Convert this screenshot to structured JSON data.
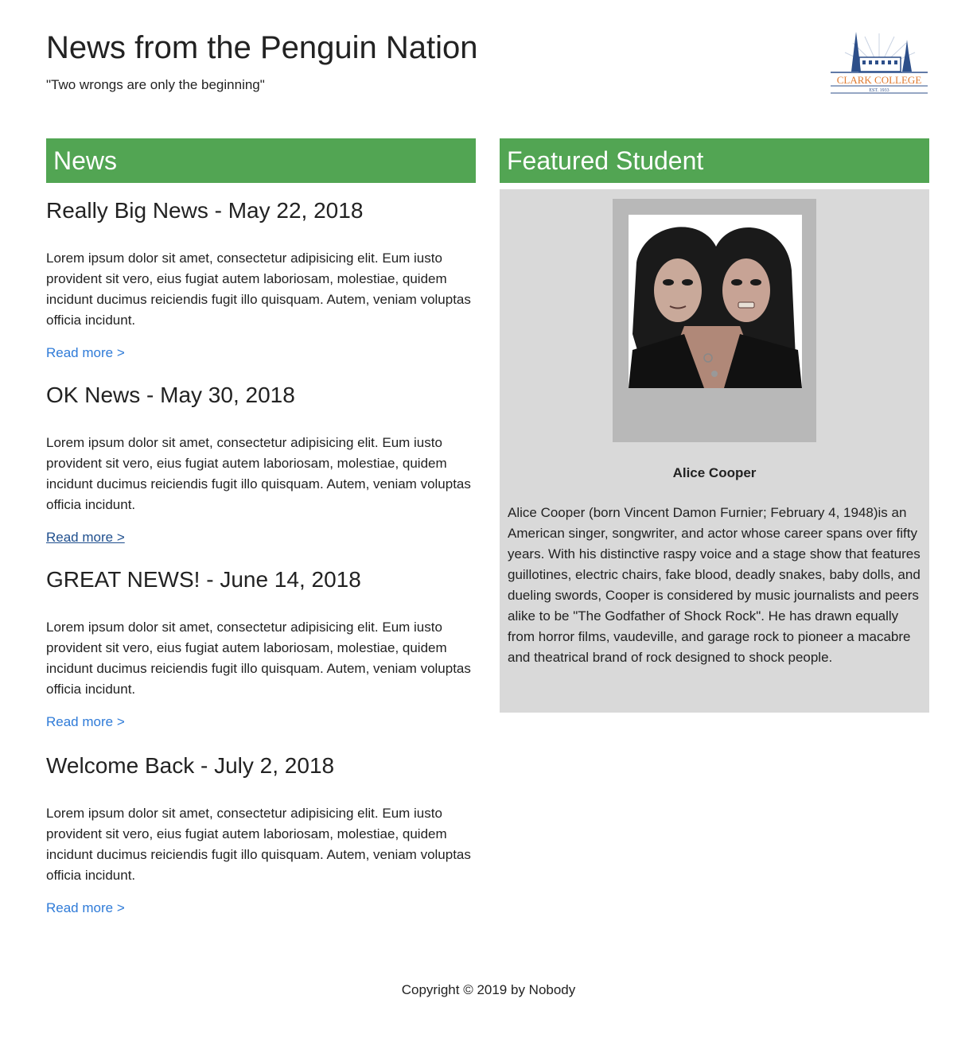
{
  "header": {
    "title": "News from the Penguin Nation",
    "tagline": "\"Two wrongs are only the beginning\"",
    "logo": {
      "icon": "clark-college-logo",
      "text": "CLARK COLLEGE",
      "est": "EST. 1933",
      "colors": {
        "blue": "#2d4f8a",
        "orange": "#e07a2f"
      }
    }
  },
  "news": {
    "heading": "News",
    "articles": [
      {
        "title": "Really Big News - May 22, 2018",
        "body": "Lorem ipsum dolor sit amet, consectetur adipisicing elit. Eum iusto provident sit vero, eius fugiat autem laboriosam, molestiae, quidem incidunt ducimus reiciendis fugit illo quisquam. Autem, veniam voluptas officia incidunt.",
        "link": "Read more >"
      },
      {
        "title": "OK News - May 30, 2018",
        "body": "Lorem ipsum dolor sit amet, consectetur adipisicing elit. Eum iusto provident sit vero, eius fugiat autem laboriosam, molestiae, quidem incidunt ducimus reiciendis fugit illo quisquam. Autem, veniam voluptas officia incidunt.",
        "link": "Read more >"
      },
      {
        "title": "GREAT NEWS! - June 14, 2018",
        "body": "Lorem ipsum dolor sit amet, consectetur adipisicing elit. Eum iusto provident sit vero, eius fugiat autem laboriosam, molestiae, quidem incidunt ducimus reiciendis fugit illo quisquam. Autem, veniam voluptas officia incidunt.",
        "link": "Read more >"
      },
      {
        "title": "Welcome Back - July 2, 2018",
        "body": "Lorem ipsum dolor sit amet, consectetur adipisicing elit. Eum iusto provident sit vero, eius fugiat autem laboriosam, molestiae, quidem incidunt ducimus reiciendis fugit illo quisquam. Autem, veniam voluptas officia incidunt.",
        "link": "Read more >"
      }
    ]
  },
  "featured": {
    "heading": "Featured Student",
    "photo_icon": "student-photo",
    "name": "Alice Cooper",
    "bio": "Alice Cooper (born Vincent Damon Furnier; February 4, 1948)is an American singer, songwriter, and actor whose career spans over fifty years. With his distinctive raspy voice and a stage show that features guillotines, electric chairs, fake blood, deadly snakes, baby dolls, and dueling swords, Cooper is considered by music journalists and peers alike to be \"The Godfather of Shock Rock\". He has drawn equally from horror films, vaudeville, and garage rock to pioneer a macabre and theatrical brand of rock designed to shock people."
  },
  "footer": {
    "copyright": "Copyright © 2019 by Nobody"
  },
  "colors": {
    "heading_bg": "#52a553",
    "panel_bg": "#d9d9d9",
    "frame_bg": "#b8b8b8",
    "link": "#2f7bd8",
    "link_visited": "#1f4f8e"
  }
}
